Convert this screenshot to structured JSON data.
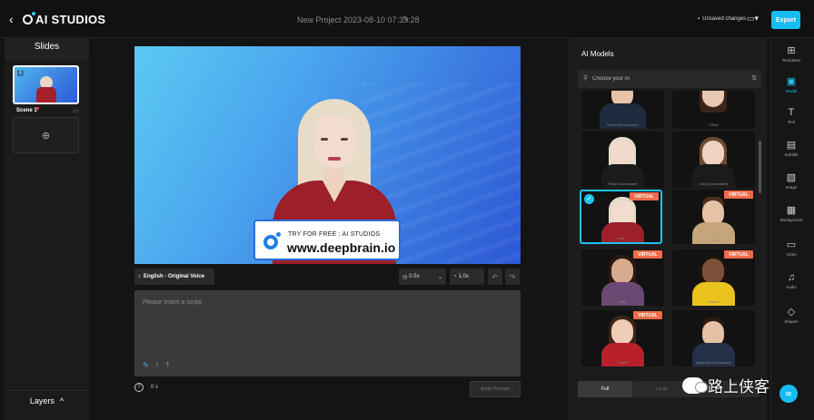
{
  "header": {
    "back_icon": "‹",
    "logo_text": "AI STUDIOS",
    "project_title": "New Project 2023-08-10 07:33:28",
    "unsaved_label": "Unsaved changes",
    "ratio_icon": "▭▾",
    "export_label": "Export"
  },
  "slides": {
    "title": "Slides",
    "scenes": [
      {
        "label": "Scene 1",
        "number": "1"
      }
    ],
    "add_icon": "⊕",
    "layers_label": "Layers",
    "layers_chevron": "^"
  },
  "canvas": {
    "promo_top": "TRY FOR FREE : AI STUDIOS",
    "promo_url": "www.deepbrain.io"
  },
  "controls": {
    "voice_icon": "♪",
    "voice_label": "English - Original Voice",
    "pause_value": "0.5s",
    "speed_value": "1.0x",
    "undo_icon": "↶",
    "redo_icon": "↷"
  },
  "script": {
    "placeholder": "Please insert a script",
    "duration": "0 s",
    "audio_preview_label": "Audio Preview"
  },
  "models": {
    "title": "AI Models",
    "search_placeholder": "Choose your AI",
    "virtual_badge": "VIRTUAL",
    "cards": [
      {
        "name": "Daniel (Announcer)"
      },
      {
        "name": "Olivia"
      },
      {
        "name": "Ruby (Consultant)"
      },
      {
        "name": "Amy (Consultant)"
      },
      {
        "name": "Kate"
      },
      {
        "name": "Chris"
      },
      {
        "name": "Mira"
      },
      {
        "name": "Naomi"
      },
      {
        "name": "Kayla"
      },
      {
        "name": "Jonathan (Announcer)"
      }
    ],
    "tabs": {
      "full": "Full",
      "other": "Large"
    }
  },
  "rail": {
    "items": [
      {
        "icon": "⊞",
        "label": "Templates"
      },
      {
        "icon": "▣",
        "label": "Model"
      },
      {
        "icon": "T",
        "label": "Text"
      },
      {
        "icon": "▤",
        "label": "Subtitle"
      },
      {
        "icon": "▧",
        "label": "Image"
      },
      {
        "icon": "▦",
        "label": "Background"
      },
      {
        "icon": "▭",
        "label": "Video"
      },
      {
        "icon": "♫",
        "label": "Audio"
      },
      {
        "icon": "◇",
        "label": "Shapes"
      }
    ],
    "chat_icon": "✉"
  },
  "watermark": {
    "text": "路上侠客"
  },
  "colors": {
    "accent": "#16bdf2",
    "virtual": "#f06b4a",
    "avatar_dress": "#9c1f2a"
  }
}
